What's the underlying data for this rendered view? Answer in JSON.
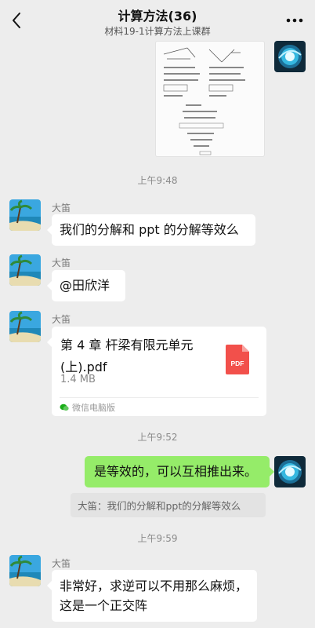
{
  "header": {
    "title": "计算方法(36)",
    "subtitle": "材料19-1计算方法上课群"
  },
  "colors": {
    "background": "#ededed",
    "my_bubble": "#95ec69",
    "their_bubble": "#ffffff",
    "pdf_red": "#f2504b",
    "wechat_green": "#1aad19"
  },
  "messages": {
    "time_1": "上午9:48",
    "sender_1": "大笛",
    "msg_1": "我们的分解和 ppt 的分解等效么",
    "sender_2": "大笛",
    "msg_2": "@田欣洋",
    "sender_3": "大笛",
    "file": {
      "name": "第 4 章  杆梁有限元单元(上).pdf",
      "size": "1.4 MB",
      "type_label": "PDF",
      "source": "微信电脑版"
    },
    "time_2": "上午9:52",
    "my_msg": "是等效的，可以互相推出来。",
    "quote": "大笛：我们的分解和ppt的分解等效么",
    "time_3": "上午9:59",
    "sender_4": "大笛",
    "msg_4": "非常好，求逆可以不用那么麻烦，这是一个正交阵"
  },
  "icons": {
    "back": "chevron-left-icon",
    "more": "more-dots-icon",
    "pdf": "pdf-file-icon",
    "source": "wechat-small-icon"
  }
}
